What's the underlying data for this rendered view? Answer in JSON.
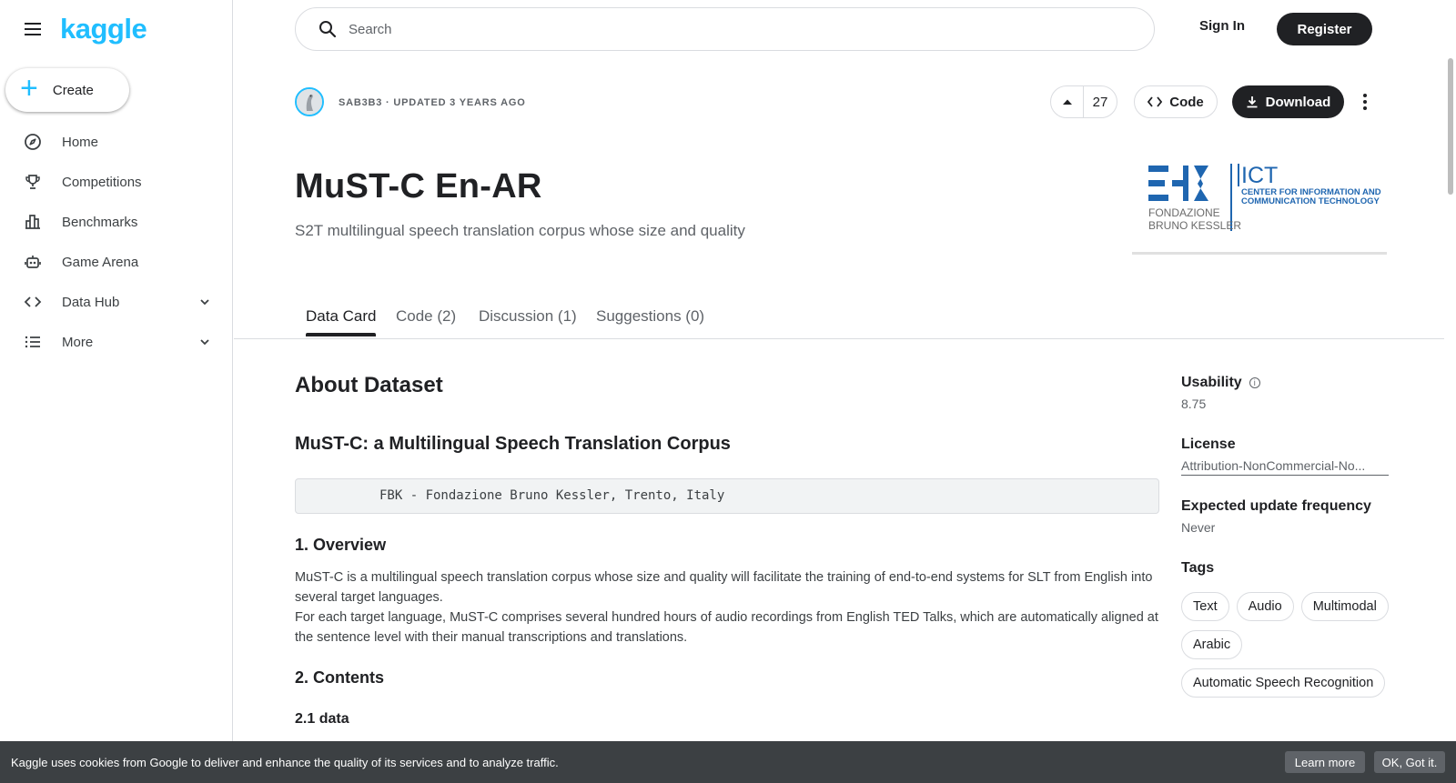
{
  "sidebar": {
    "logo": "kaggle",
    "create_label": "Create",
    "items": [
      {
        "label": "Home",
        "icon": "compass-icon"
      },
      {
        "label": "Competitions",
        "icon": "trophy-icon"
      },
      {
        "label": "Benchmarks",
        "icon": "bar-chart-icon"
      },
      {
        "label": "Game Arena",
        "icon": "robot-icon"
      },
      {
        "label": "Data Hub",
        "icon": "code-brackets-icon"
      },
      {
        "label": "More",
        "icon": "list-icon"
      }
    ]
  },
  "header": {
    "search_placeholder": "Search",
    "sign_in": "Sign In",
    "register": "Register"
  },
  "dataset": {
    "meta": "SAB3B3 · UPDATED 3 YEARS AGO",
    "votes": "27",
    "code_label": "Code",
    "download_label": "Download",
    "title": "MuST-C En-AR",
    "subtitle": "S2T multilingual speech translation corpus whose size and quality",
    "logo": {
      "line1": "FONDAZIONE",
      "line2": "BRUNO KESSLER",
      "ict": "ICT",
      "ict_line1": "CENTER FOR INFORMATION AND",
      "ict_line2": "COMMUNICATION TECHNOLOGY"
    }
  },
  "tabs": [
    {
      "label": "Data Card",
      "active": true
    },
    {
      "label": "Code (2)",
      "active": false
    },
    {
      "label": "Discussion (1)",
      "active": false
    },
    {
      "label": "Suggestions (0)",
      "active": false
    }
  ],
  "content": {
    "about_heading": "About Dataset",
    "corpus_heading": "MuST-C: a Multilingual Speech Translation Corpus",
    "code_line": "FBK - Fondazione Bruno Kessler, Trento, Italy",
    "overview_heading": "1. Overview",
    "overview_p1": "MuST-C is a multilingual speech translation corpus whose size and quality will facilitate the training of end-to-end systems for SLT from English into several target languages.",
    "overview_p2": "For each target language, MuST-C comprises several hundred hours of audio recordings from English TED Talks, which are automatically aligned at the sentence level with their manual transcriptions and translations.",
    "contents_heading": "2. Contents",
    "data_heading": "2.1 data"
  },
  "right_panel": {
    "usability_label": "Usability",
    "usability_value": "8.75",
    "license_label": "License",
    "license_value": "Attribution-NonCommercial-No...",
    "frequency_label": "Expected update frequency",
    "frequency_value": "Never",
    "tags_label": "Tags",
    "tags": [
      "Text",
      "Audio",
      "Multimodal",
      "Arabic",
      "Automatic Speech Recognition"
    ]
  },
  "cookie": {
    "text": "Kaggle uses cookies from Google to deliver and enhance the quality of its services and to analyze traffic.",
    "learn_more": "Learn more",
    "ok": "OK, Got it."
  },
  "colors": {
    "brand": "#20beff",
    "primary_dark": "#202124",
    "fbk_blue": "#1f66b0"
  }
}
